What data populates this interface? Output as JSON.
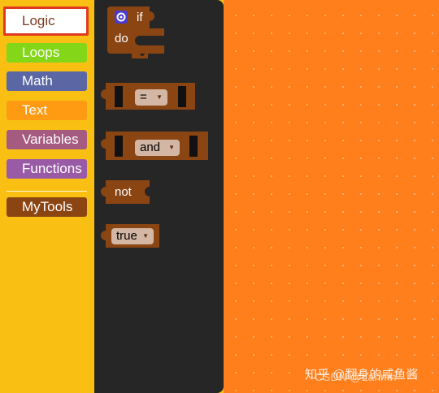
{
  "toolbox": {
    "categories": [
      {
        "label": "Logic",
        "color": "#ffffff",
        "selected": true
      },
      {
        "label": "Loops",
        "color": "#84d619"
      },
      {
        "label": "Math",
        "color": "#5b67a5"
      },
      {
        "label": "Text",
        "color": "#fe9b13"
      },
      {
        "label": "Variables",
        "color": "#a55b80"
      },
      {
        "label": "Functions",
        "color": "#995ba5"
      },
      {
        "label": "MyTools",
        "color": "#8b4513"
      }
    ]
  },
  "flyout": {
    "if_block": {
      "if": "if",
      "do": "do"
    },
    "compare_block": {
      "op": "="
    },
    "and_block": {
      "op": "and"
    },
    "not_block": {
      "label": "not"
    },
    "bool_block": {
      "value": "true"
    }
  },
  "colors": {
    "block": "#8b4513",
    "workspace": "#ff7f1c",
    "flyout": "#262626",
    "toolbox": "#f9c013"
  },
  "watermark": {
    "line1": "知乎 @翻身的咸鱼酱",
    "line2": "CSDN @Lahmn"
  }
}
